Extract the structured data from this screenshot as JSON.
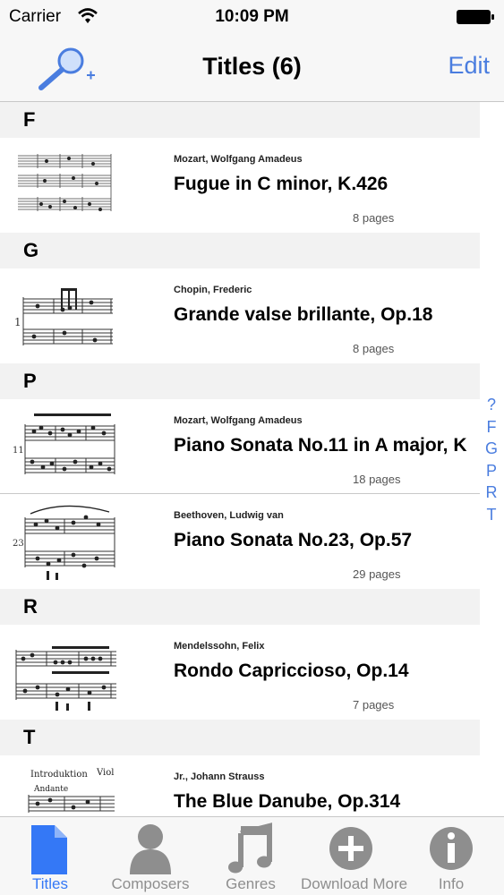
{
  "status": {
    "carrier": "Carrier",
    "time": "10:09 PM"
  },
  "nav": {
    "title": "Titles (6)",
    "edit": "Edit"
  },
  "sections": [
    {
      "letter": "F",
      "rows": [
        {
          "composer": "Mozart, Wolfgang Amadeus",
          "title": "Fugue in C minor, K.426",
          "pages": "8 pages"
        }
      ]
    },
    {
      "letter": "G",
      "rows": [
        {
          "composer": "Chopin, Frederic",
          "title": "Grande valse brillante, Op.18",
          "pages": "8 pages"
        }
      ]
    },
    {
      "letter": "P",
      "rows": [
        {
          "composer": "Mozart, Wolfgang Amadeus",
          "title": "Piano Sonata No.11 in A major, K",
          "pages": "18 pages"
        },
        {
          "composer": "Beethoven, Ludwig van",
          "title": "Piano Sonata No.23, Op.57",
          "pages": "29 pages"
        }
      ]
    },
    {
      "letter": "R",
      "rows": [
        {
          "composer": "Mendelssohn, Felix",
          "title": "Rondo Capriccioso, Op.14",
          "pages": "7 pages"
        }
      ]
    },
    {
      "letter": "T",
      "rows": [
        {
          "composer": "Jr., Johann Strauss",
          "title": "The Blue Danube, Op.314",
          "pages": ""
        }
      ]
    }
  ],
  "index": [
    "?",
    "F",
    "G",
    "P",
    "R",
    "T"
  ],
  "tabs": [
    {
      "label": "Titles",
      "icon": "document-icon",
      "active": true
    },
    {
      "label": "Composers",
      "icon": "person-icon",
      "active": false
    },
    {
      "label": "Genres",
      "icon": "music-note-icon",
      "active": false
    },
    {
      "label": "Download More",
      "icon": "plus-circle-icon",
      "active": false
    },
    {
      "label": "Info",
      "icon": "info-icon",
      "active": false
    }
  ],
  "colors": {
    "accent": "#4a7ddf",
    "tab_active": "#3478f6",
    "tab_inactive": "#8e8e8e",
    "section_bg": "#f2f2f2"
  }
}
